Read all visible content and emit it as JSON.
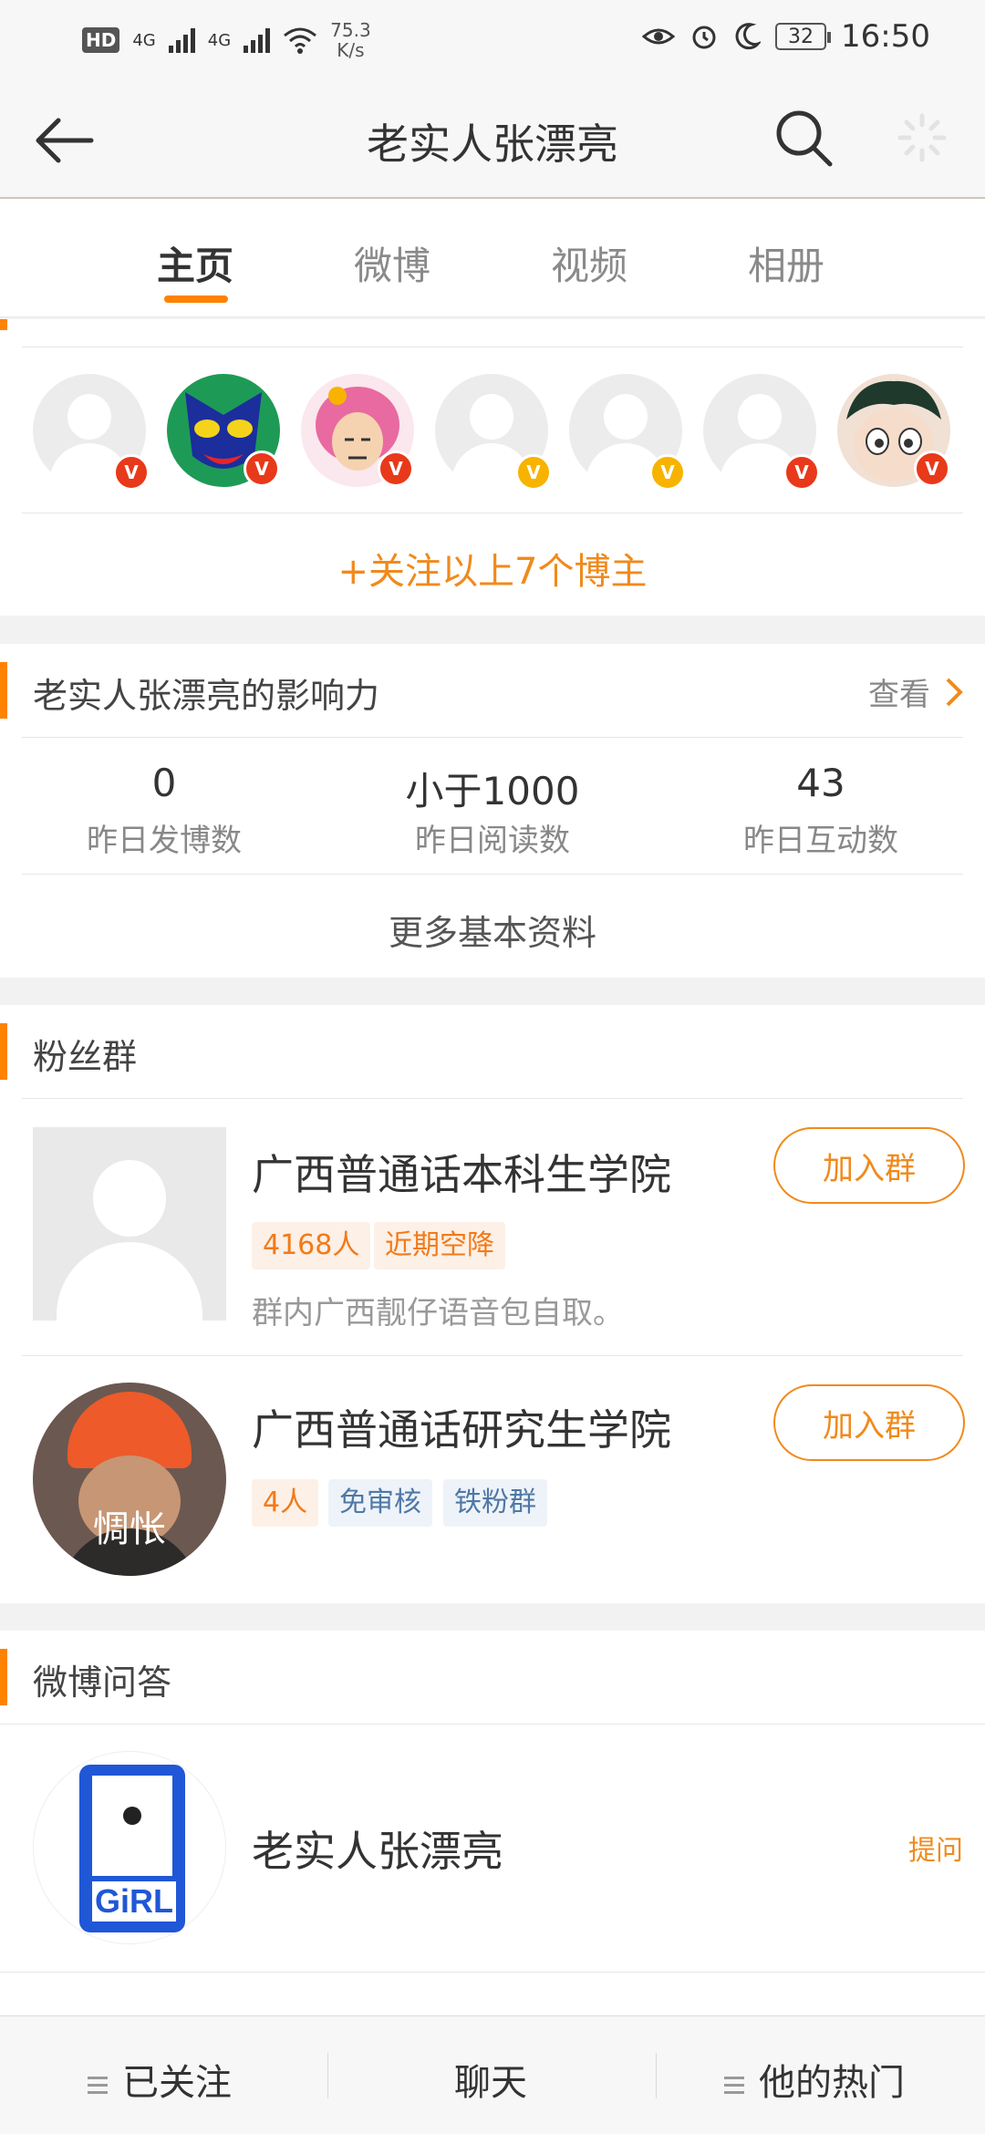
{
  "status_bar": {
    "network_badges": [
      "HD",
      "4G",
      "4G"
    ],
    "speed_value": "75.3",
    "speed_unit": "K/s",
    "battery": "32",
    "time": "16:50"
  },
  "header": {
    "title": "老实人张漂亮"
  },
  "tabs": [
    {
      "label": "主页"
    },
    {
      "label": "微博"
    },
    {
      "label": "视频"
    },
    {
      "label": "相册"
    }
  ],
  "recommend": {
    "follow_all_label": "+关注以上7个博主"
  },
  "influence": {
    "title": "老实人张漂亮的影响力",
    "view_label": "查看",
    "stats": [
      {
        "value": "0",
        "label": "昨日发博数"
      },
      {
        "value": "小于1000",
        "label": "昨日阅读数"
      },
      {
        "value": "43",
        "label": "昨日互动数"
      }
    ],
    "more_label": "更多基本资料"
  },
  "fan_groups": {
    "title": "粉丝群",
    "groups": [
      {
        "name": "广西普通话本科生学院",
        "tags": [
          "4168人",
          "近期空降"
        ],
        "desc": "群内广西靓仔语音包自取。",
        "join_label": "加入群"
      },
      {
        "name": "广西普通话研究生学院",
        "tags": [
          "4人",
          "免审核",
          "铁粉群"
        ],
        "avatar_caption": "惆怅",
        "join_label": "加入群"
      }
    ]
  },
  "qa": {
    "title": "微博问答",
    "user_name": "老实人张漂亮",
    "ask_label": "提问",
    "logo_text": "GiRL"
  },
  "bottom_bar": {
    "followed_label": "已关注",
    "chat_label": "聊天",
    "hot_label": "他的热门"
  },
  "colors": {
    "accent": "#ff8200",
    "link_orange": "#f08a1c",
    "badge_red": "#e8391a",
    "badge_yellow": "#f7b300"
  }
}
